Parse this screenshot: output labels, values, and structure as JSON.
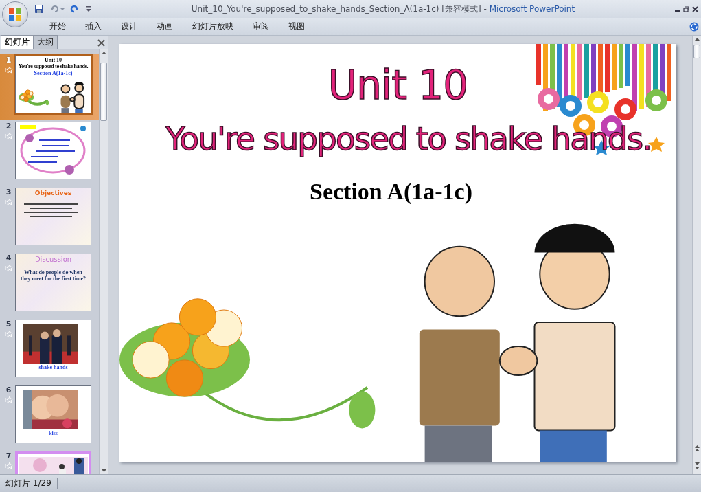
{
  "window": {
    "title": "Unit_10_You're_supposed_to_shake_hands_Section_A(1a-1c) [兼容模式] - ",
    "app": "Microsoft PowerPoint"
  },
  "ribbon_tabs": [
    {
      "label": "开始"
    },
    {
      "label": "插入"
    },
    {
      "label": "设计"
    },
    {
      "label": "动画"
    },
    {
      "label": "幻灯片放映"
    },
    {
      "label": "审阅"
    },
    {
      "label": "视图"
    }
  ],
  "panel_tabs": [
    {
      "label": "幻灯片",
      "selected": true
    },
    {
      "label": "大纲",
      "selected": false
    }
  ],
  "thumbnails": [
    {
      "number": "1",
      "selected": true,
      "kind": "title",
      "texts": [
        "Unit 10",
        "You're supposed to shake hands.",
        "Section A(1a-1c)"
      ]
    },
    {
      "number": "2",
      "selected": false,
      "kind": "vocab"
    },
    {
      "number": "3",
      "selected": false,
      "kind": "text",
      "texts": [
        "Objectives"
      ]
    },
    {
      "number": "4",
      "selected": false,
      "kind": "text",
      "texts": [
        "Discussion",
        "What do people do when they meet for the first time?"
      ]
    },
    {
      "number": "5",
      "selected": false,
      "texts": [
        "shake hands"
      ]
    },
    {
      "number": "6",
      "selected": false,
      "texts": [
        "kiss"
      ]
    },
    {
      "number": "7",
      "selected": false,
      "kind": "partial"
    }
  ],
  "slide": {
    "title": "Unit 10",
    "subtitle": "You're supposed to shake hands.",
    "section": "Section A(1a-1c)"
  },
  "status_bar": {
    "slide_counter": "幻灯片 1/29"
  }
}
